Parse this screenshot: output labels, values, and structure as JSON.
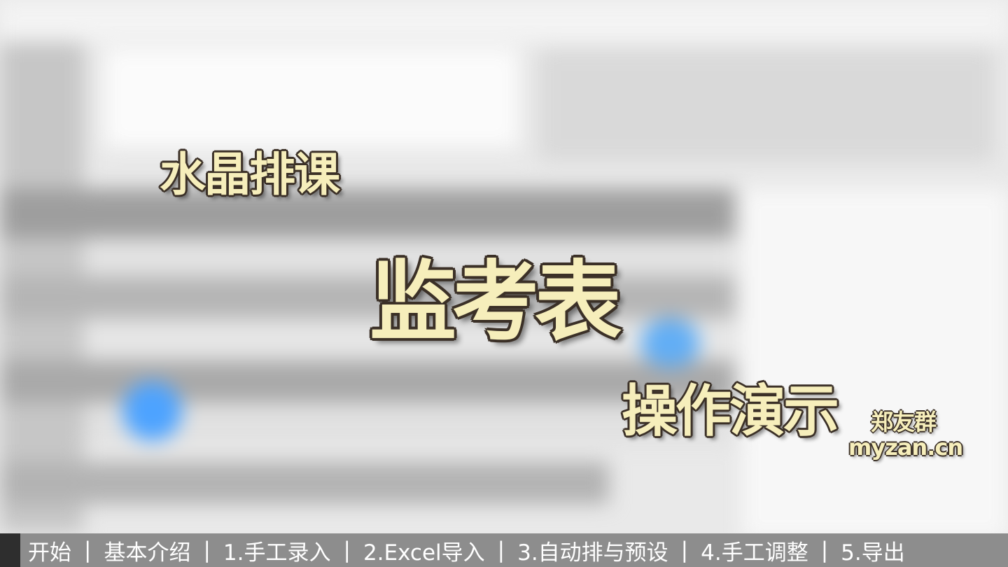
{
  "overlay": {
    "app_name": "水晶排课",
    "main_title": "监考表",
    "subtitle": "操作演示",
    "author": "郑友群",
    "website": "myzan.cn",
    "text_color": "#f6eebb",
    "outline_color": "#3b3027"
  },
  "chapter_bar": {
    "background": "#8d8d8d",
    "progress_fraction": 0.02,
    "separator": "|",
    "chapters": [
      "开始",
      "基本介绍",
      "1.手工录入",
      "2.Excel导入",
      "3.自动排与预设",
      "4.手工调整",
      "5.导出"
    ]
  }
}
